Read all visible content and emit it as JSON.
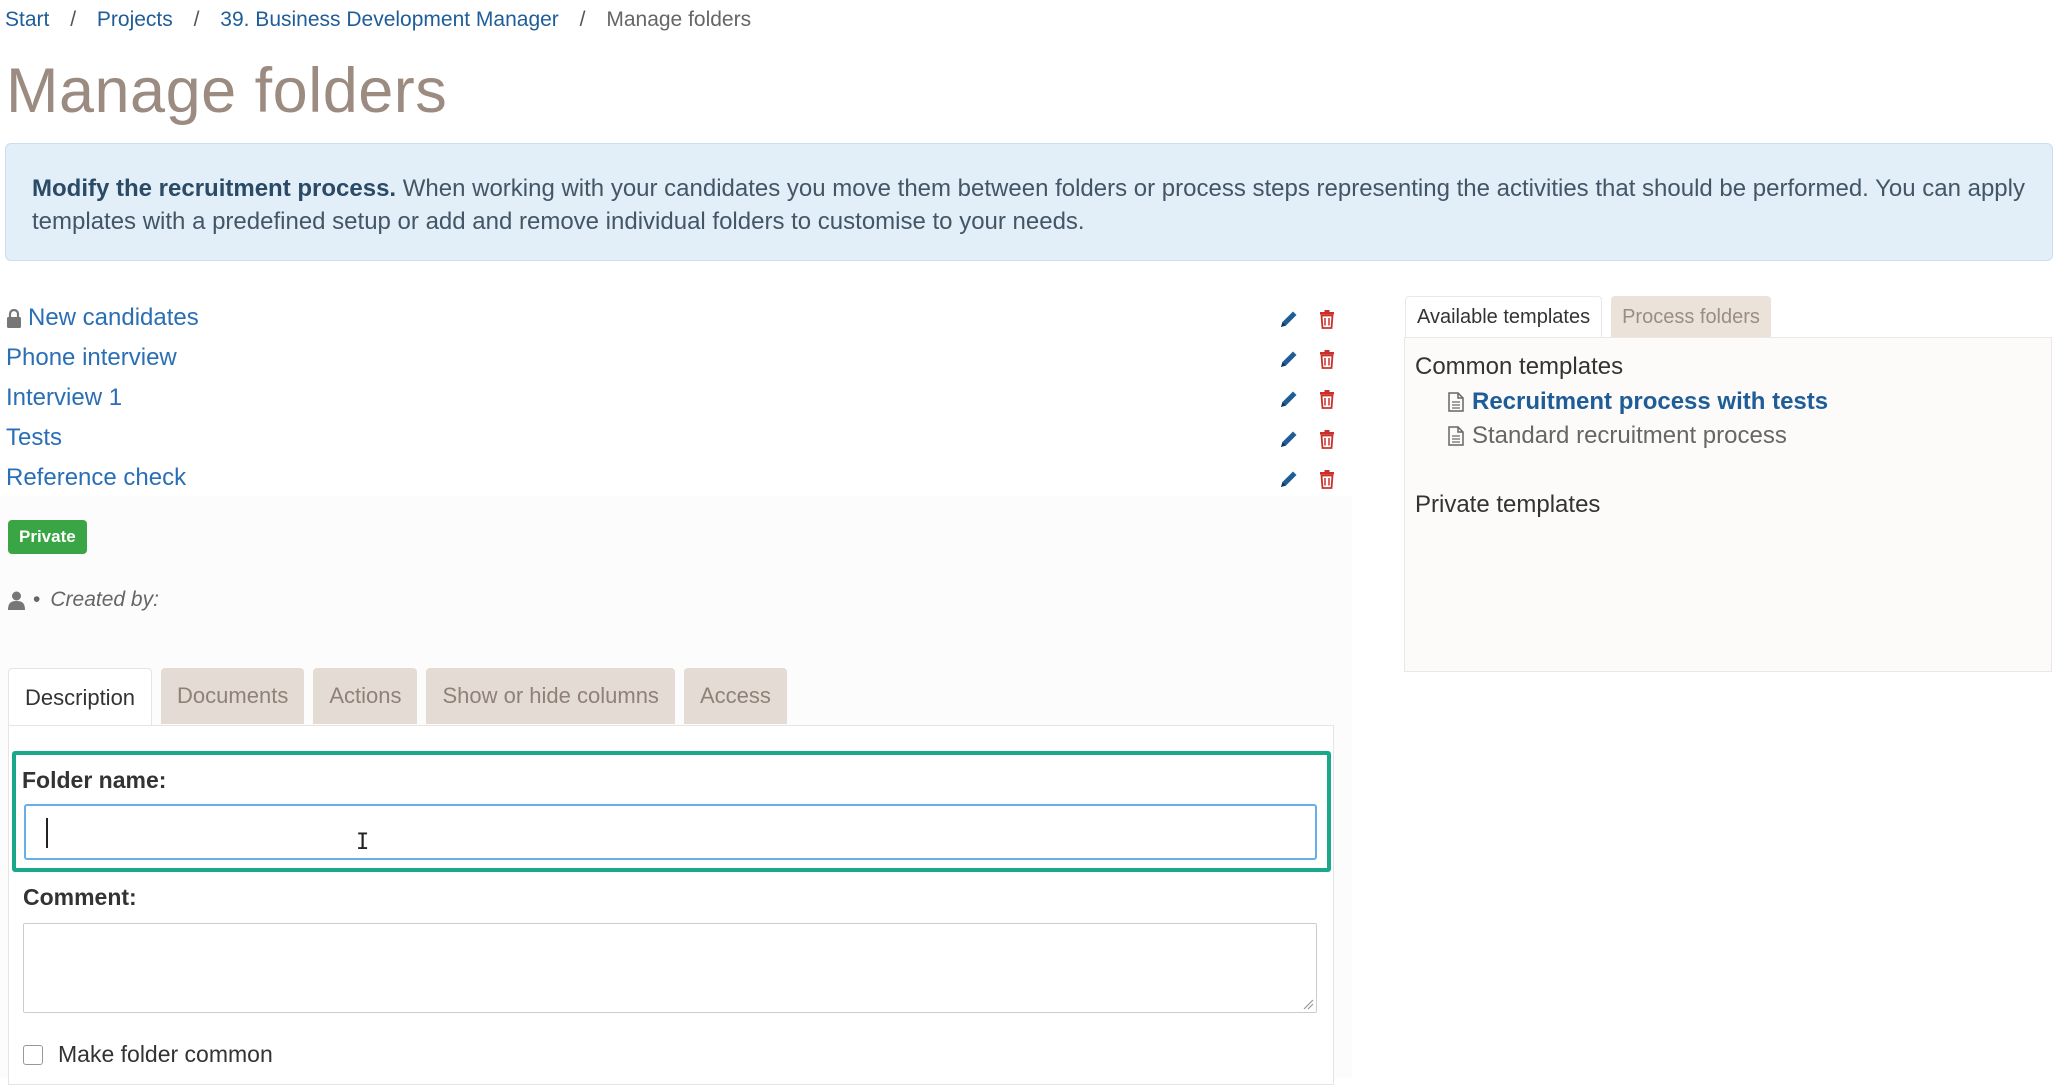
{
  "breadcrumb": {
    "items": [
      "Start",
      "Projects",
      "39. Business Development Manager",
      "Manage folders"
    ],
    "separator": "/"
  },
  "page_title": "Manage folders",
  "info": {
    "lead": "Modify the recruitment process.",
    "text": " When working with your candidates you move them between folders or process steps representing the activities that should be performed. You can apply templates with a predefined setup or add and remove individual folders to customise to your needs."
  },
  "folders": [
    {
      "name": "New candidates",
      "locked": true
    },
    {
      "name": "Phone interview",
      "locked": false
    },
    {
      "name": "Interview 1",
      "locked": false
    },
    {
      "name": "Tests",
      "locked": false
    },
    {
      "name": "Reference check",
      "locked": false
    }
  ],
  "badge": "Private",
  "created_by": {
    "bullet": "•",
    "label": "Created by:"
  },
  "tabs": [
    "Description",
    "Documents",
    "Actions",
    "Show or hide columns",
    "Access"
  ],
  "form": {
    "folder_name_label": "Folder name:",
    "folder_name_value": "",
    "comment_label": "Comment:",
    "comment_value": "",
    "make_common_label": "Make folder common"
  },
  "right_tabs": [
    "Available templates",
    "Process folders"
  ],
  "templates": {
    "common_heading": "Common templates",
    "common": [
      "Recruitment process with tests",
      "Standard recruitment process"
    ],
    "private_heading": "Private templates"
  },
  "colors": {
    "link": "#2a6fb5",
    "accent_border": "#1aa88a",
    "badge_green": "#3aa544",
    "delete_red": "#c9302c",
    "edit_blue": "#1f5d99"
  },
  "icons": {
    "lock": "lock-icon",
    "edit": "pencil-icon",
    "delete": "trash-icon",
    "user": "user-icon",
    "document": "document-icon"
  }
}
